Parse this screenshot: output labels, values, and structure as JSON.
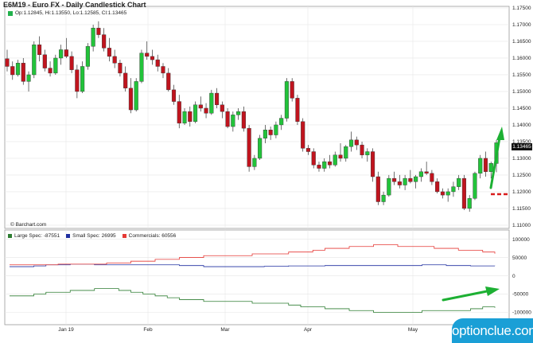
{
  "header": {
    "title": "E6M19 - Euro FX - Daily Candlestick Chart",
    "ohlc": "Op:1.12845, Hi:1.13550, Lo:1.12585, Cl:1.13465",
    "credit": "© Barchart.com",
    "last_price": "1.13465"
  },
  "colors": {
    "up": "#22c33a",
    "down": "#c0141e",
    "large_spec": "#2e7d32",
    "small_spec": "#1f2fa0",
    "commercials": "#e53935",
    "annotation_arrow": "#1db033",
    "annotation_dash": "#d81b1b",
    "grid": "#e6e6e6",
    "logo_bg": "#1a9fd6"
  },
  "logo": {
    "text": "optionclue.com"
  },
  "chart_data": [
    {
      "type": "candlestick",
      "title": "E6M19 - Euro FX - Daily Candlestick Chart",
      "x_labels": [
        "Jan 19",
        "Feb",
        "Mar",
        "Apr",
        "May"
      ],
      "y_ticks": [
        "1.17500",
        "1.17000",
        "1.16500",
        "1.16000",
        "1.15500",
        "1.15000",
        "1.14500",
        "1.14000",
        "1.13500",
        "1.13000",
        "1.12500",
        "1.12000",
        "1.11500",
        "1.11000"
      ],
      "ylim": [
        1.1095,
        1.175
      ],
      "grid": true,
      "last": {
        "open": 1.12845,
        "high": 1.1355,
        "low": 1.12585,
        "close": 1.13465
      },
      "candles": [
        [
          1.1598,
          1.1625,
          1.156,
          1.1575
        ],
        [
          1.1575,
          1.159,
          1.1535,
          1.155
        ],
        [
          1.155,
          1.1595,
          1.1545,
          1.1585
        ],
        [
          1.1585,
          1.16,
          1.152,
          1.153
        ],
        [
          1.153,
          1.156,
          1.15,
          1.155
        ],
        [
          1.155,
          1.165,
          1.154,
          1.164
        ],
        [
          1.164,
          1.1665,
          1.159,
          1.161
        ],
        [
          1.161,
          1.1625,
          1.156,
          1.157
        ],
        [
          1.157,
          1.159,
          1.1545,
          1.1555
        ],
        [
          1.1555,
          1.161,
          1.155,
          1.16
        ],
        [
          1.16,
          1.164,
          1.158,
          1.1625
        ],
        [
          1.1625,
          1.166,
          1.16,
          1.1605
        ],
        [
          1.1605,
          1.162,
          1.1555,
          1.1565
        ],
        [
          1.1565,
          1.158,
          1.148,
          1.15
        ],
        [
          1.15,
          1.159,
          1.1495,
          1.1575
        ],
        [
          1.1575,
          1.1645,
          1.1565,
          1.1635
        ],
        [
          1.1635,
          1.17,
          1.162,
          1.169
        ],
        [
          1.169,
          1.171,
          1.166,
          1.167
        ],
        [
          1.167,
          1.169,
          1.162,
          1.163
        ],
        [
          1.163,
          1.166,
          1.159,
          1.1605
        ],
        [
          1.1605,
          1.1625,
          1.157,
          1.1585
        ],
        [
          1.1585,
          1.1595,
          1.1545,
          1.1555
        ],
        [
          1.1555,
          1.1575,
          1.15,
          1.151
        ],
        [
          1.151,
          1.154,
          1.1435,
          1.1445
        ],
        [
          1.1445,
          1.154,
          1.144,
          1.153
        ],
        [
          1.153,
          1.1625,
          1.1525,
          1.1615
        ],
        [
          1.1615,
          1.165,
          1.1595,
          1.1605
        ],
        [
          1.1605,
          1.1625,
          1.158,
          1.1595
        ],
        [
          1.1595,
          1.161,
          1.156,
          1.1575
        ],
        [
          1.1575,
          1.1585,
          1.154,
          1.1555
        ],
        [
          1.1555,
          1.157,
          1.15,
          1.1505
        ],
        [
          1.1505,
          1.152,
          1.146,
          1.147
        ],
        [
          1.147,
          1.149,
          1.139,
          1.1405
        ],
        [
          1.1405,
          1.145,
          1.14,
          1.144
        ],
        [
          1.144,
          1.1455,
          1.1395,
          1.141
        ],
        [
          1.141,
          1.147,
          1.1405,
          1.146
        ],
        [
          1.146,
          1.1485,
          1.144,
          1.145
        ],
        [
          1.145,
          1.1465,
          1.142,
          1.1435
        ],
        [
          1.1435,
          1.1505,
          1.143,
          1.1495
        ],
        [
          1.1495,
          1.151,
          1.145,
          1.146
        ],
        [
          1.146,
          1.147,
          1.142,
          1.144
        ],
        [
          1.144,
          1.145,
          1.139,
          1.1395
        ],
        [
          1.1395,
          1.144,
          1.138,
          1.143
        ],
        [
          1.143,
          1.145,
          1.1415,
          1.144
        ],
        [
          1.144,
          1.1455,
          1.138,
          1.139
        ],
        [
          1.139,
          1.14,
          1.126,
          1.1275
        ],
        [
          1.1275,
          1.131,
          1.1265,
          1.13
        ],
        [
          1.13,
          1.137,
          1.1295,
          1.136
        ],
        [
          1.136,
          1.14,
          1.1345,
          1.1385
        ],
        [
          1.1385,
          1.1395,
          1.1355,
          1.137
        ],
        [
          1.137,
          1.141,
          1.136,
          1.14
        ],
        [
          1.14,
          1.143,
          1.1385,
          1.142
        ],
        [
          1.142,
          1.154,
          1.141,
          1.153
        ],
        [
          1.153,
          1.154,
          1.147,
          1.148
        ],
        [
          1.148,
          1.149,
          1.14,
          1.141
        ],
        [
          1.141,
          1.142,
          1.132,
          1.133
        ],
        [
          1.133,
          1.134,
          1.131,
          1.132
        ],
        [
          1.132,
          1.133,
          1.127,
          1.128
        ],
        [
          1.128,
          1.129,
          1.126,
          1.127
        ],
        [
          1.127,
          1.13,
          1.126,
          1.129
        ],
        [
          1.129,
          1.131,
          1.127,
          1.128
        ],
        [
          1.128,
          1.132,
          1.1275,
          1.131
        ],
        [
          1.131,
          1.1345,
          1.129,
          1.13
        ],
        [
          1.13,
          1.134,
          1.129,
          1.1335
        ],
        [
          1.1335,
          1.138,
          1.132,
          1.1355
        ],
        [
          1.1355,
          1.1365,
          1.1325,
          1.134
        ],
        [
          1.134,
          1.135,
          1.13,
          1.131
        ],
        [
          1.131,
          1.133,
          1.129,
          1.132
        ],
        [
          1.132,
          1.133,
          1.123,
          1.1245
        ],
        [
          1.1245,
          1.126,
          1.116,
          1.117
        ],
        [
          1.117,
          1.12,
          1.116,
          1.119
        ],
        [
          1.119,
          1.125,
          1.1185,
          1.124
        ],
        [
          1.124,
          1.126,
          1.122,
          1.123
        ],
        [
          1.123,
          1.125,
          1.121,
          1.122
        ],
        [
          1.122,
          1.125,
          1.1205,
          1.124
        ],
        [
          1.124,
          1.1265,
          1.1225,
          1.123
        ],
        [
          1.123,
          1.125,
          1.121,
          1.1245
        ],
        [
          1.1245,
          1.127,
          1.123,
          1.126
        ],
        [
          1.126,
          1.129,
          1.125,
          1.1255
        ],
        [
          1.1255,
          1.1265,
          1.122,
          1.123
        ],
        [
          1.123,
          1.124,
          1.1195,
          1.12
        ],
        [
          1.12,
          1.121,
          1.118,
          1.119
        ],
        [
          1.119,
          1.121,
          1.117,
          1.12
        ],
        [
          1.12,
          1.123,
          1.1185,
          1.1215
        ],
        [
          1.1215,
          1.125,
          1.1205,
          1.124
        ],
        [
          1.124,
          1.125,
          1.1145,
          1.115
        ],
        [
          1.115,
          1.119,
          1.114,
          1.118
        ],
        [
          1.118,
          1.126,
          1.1175,
          1.1255
        ],
        [
          1.1255,
          1.131,
          1.124,
          1.13
        ],
        [
          1.13,
          1.132,
          1.1245,
          1.126
        ],
        [
          1.126,
          1.129,
          1.124,
          1.1285
        ],
        [
          1.12845,
          1.1355,
          1.12585,
          1.13465
        ]
      ]
    },
    {
      "type": "line",
      "title": "",
      "legend_position": "top-left",
      "y_ticks": [
        "100000",
        "50000",
        "0",
        "-50000",
        "-100000"
      ],
      "ylim": [
        -125000,
        110000
      ],
      "series": [
        {
          "name": "Large Spec",
          "legend_label": "Large Spec: -87551",
          "values": [
            -55000,
            -55000,
            -50000,
            -45000,
            -45000,
            -40000,
            -40000,
            -35000,
            -35000,
            -40000,
            -45000,
            -50000,
            -55000,
            -60000,
            -65000,
            -65000,
            -70000,
            -70000,
            -70000,
            -70000,
            -75000,
            -75000,
            -75000,
            -80000,
            -85000,
            -85000,
            -90000,
            -90000,
            -95000,
            -95000,
            -100000,
            -100000,
            -100000,
            -100000,
            -95000,
            -95000,
            -95000,
            -95000,
            -90000,
            -85000,
            -87551
          ]
        },
        {
          "name": "Small Spec",
          "legend_label": "Small Spec: 26995",
          "values": [
            25000,
            25000,
            27000,
            30000,
            30000,
            32000,
            32000,
            30000,
            30000,
            30000,
            30000,
            30000,
            30000,
            30000,
            28000,
            28000,
            25000,
            25000,
            25000,
            25000,
            25000,
            26000,
            26000,
            27000,
            27000,
            27000,
            28000,
            28000,
            28000,
            28000,
            28000,
            28000,
            28000,
            28000,
            30000,
            30000,
            28000,
            28000,
            27000,
            27000,
            26995
          ]
        },
        {
          "name": "Commercials",
          "legend_label": "Commercials: 60556",
          "values": [
            30000,
            30000,
            30000,
            30000,
            32000,
            32000,
            32000,
            32000,
            35000,
            35000,
            40000,
            40000,
            45000,
            45000,
            50000,
            50000,
            55000,
            55000,
            55000,
            55000,
            60000,
            60000,
            60000,
            65000,
            65000,
            70000,
            75000,
            75000,
            80000,
            80000,
            85000,
            85000,
            80000,
            80000,
            80000,
            75000,
            75000,
            70000,
            70000,
            65000,
            60556
          ]
        }
      ]
    }
  ]
}
